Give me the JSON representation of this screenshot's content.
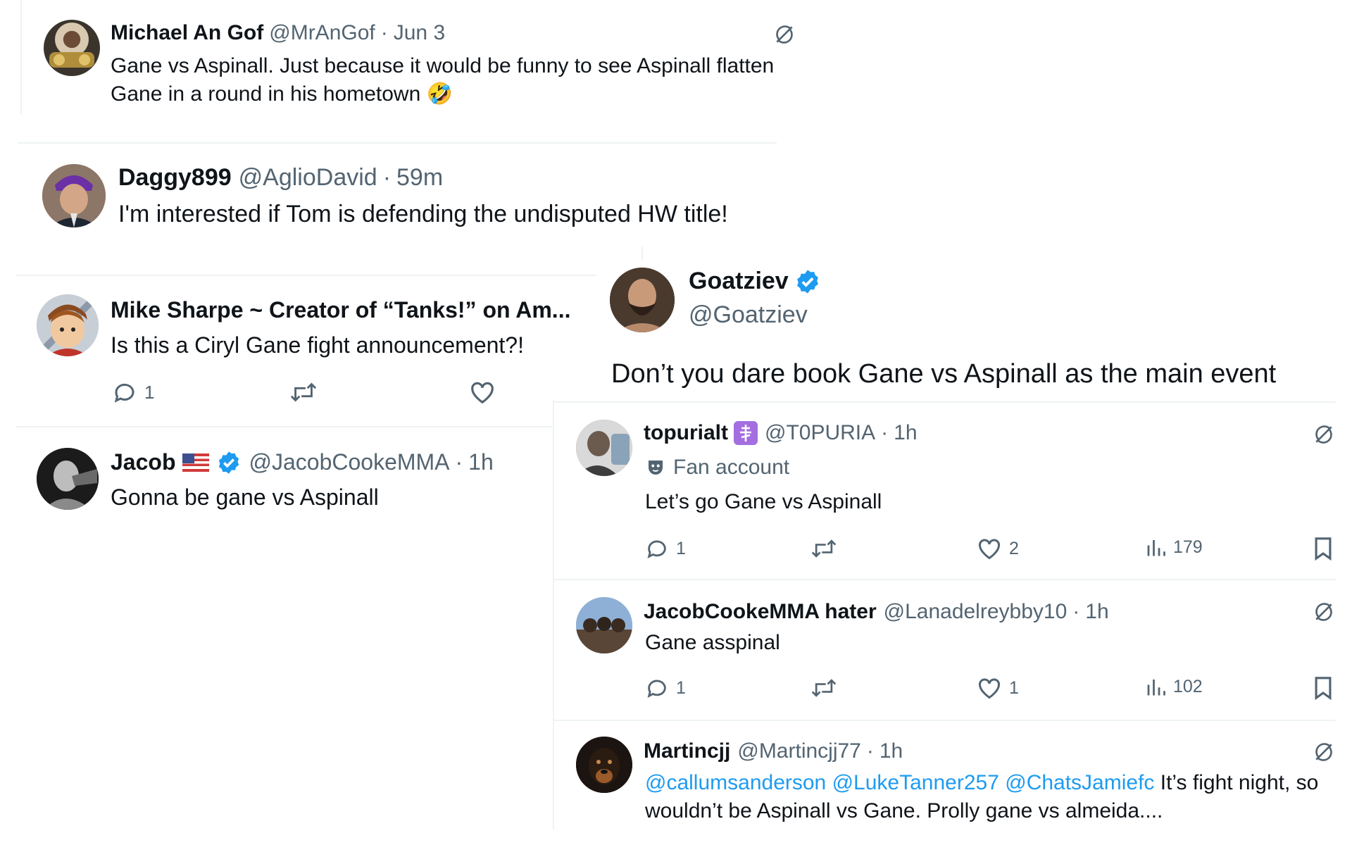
{
  "posts": {
    "michael": {
      "name": "Michael An Gof",
      "handle": "@MrAnGof",
      "sep": "·",
      "time": "Jun 3",
      "line1": "Gane vs Aspinall. Just because it would be funny to see Aspinall flatten",
      "line2": "Gane in a round in his hometown",
      "emoji": "🤣"
    },
    "daggy": {
      "name": "Daggy899",
      "handle": "@AglioDavid",
      "sep": "·",
      "time": "59m",
      "text": "I'm interested if Tom is defending the undisputed HW title!"
    },
    "mike": {
      "name": "Mike Sharpe ~ Creator of “Tanks!” on Am...",
      "text": "Is this a Ciryl Gane fight announcement?!",
      "replies": "1"
    },
    "jacob": {
      "name": "Jacob",
      "handle": "@JacobCookeMMA",
      "sep": "·",
      "time": "1h",
      "text": "Gonna be gane vs Aspinall"
    },
    "goatziev": {
      "name": "Goatziev",
      "handle": "@Goatziev",
      "text": "Don’t you dare book Gane vs Aspinall as the main event"
    },
    "topuria": {
      "name": "topurialt",
      "handle": "@T0PURIA",
      "sep": "·",
      "time": "1h",
      "fan_label": "Fan account",
      "text": "Let’s go Gane vs Aspinall",
      "replies": "1",
      "likes": "2",
      "views": "179"
    },
    "hater": {
      "name": "JacobCookeMMA hater",
      "handle": "@Lanadelreybby10",
      "sep": "·",
      "time": "1h",
      "text": "Gane asspinal",
      "replies": "1",
      "likes": "1",
      "views": "102"
    },
    "martin": {
      "name": "Martincjj",
      "handle": "@Martincjj77",
      "sep": "·",
      "time": "1h",
      "mention1": "@callumsanderson",
      "mention2": "@LukeTanner257",
      "mention3": "@ChatsJamiefc",
      "line1_rest": "It’s fight night, so",
      "line2": "wouldn’t be Aspinall vs Gane. Prolly gane vs almeida...."
    }
  },
  "icons": {
    "reply": "reply-icon",
    "repost": "repost-icon",
    "like": "heart-icon",
    "views": "views-icon",
    "bookmark": "bookmark-icon",
    "grok": "grok-icon",
    "verified": "verified-badge-icon",
    "flag": "us-flag-icon",
    "fan_mask": "mask-icon"
  },
  "colors": {
    "text": "#0f1419",
    "secondary": "#536471",
    "link": "#1d9bf0",
    "divider": "#eff3f4"
  }
}
